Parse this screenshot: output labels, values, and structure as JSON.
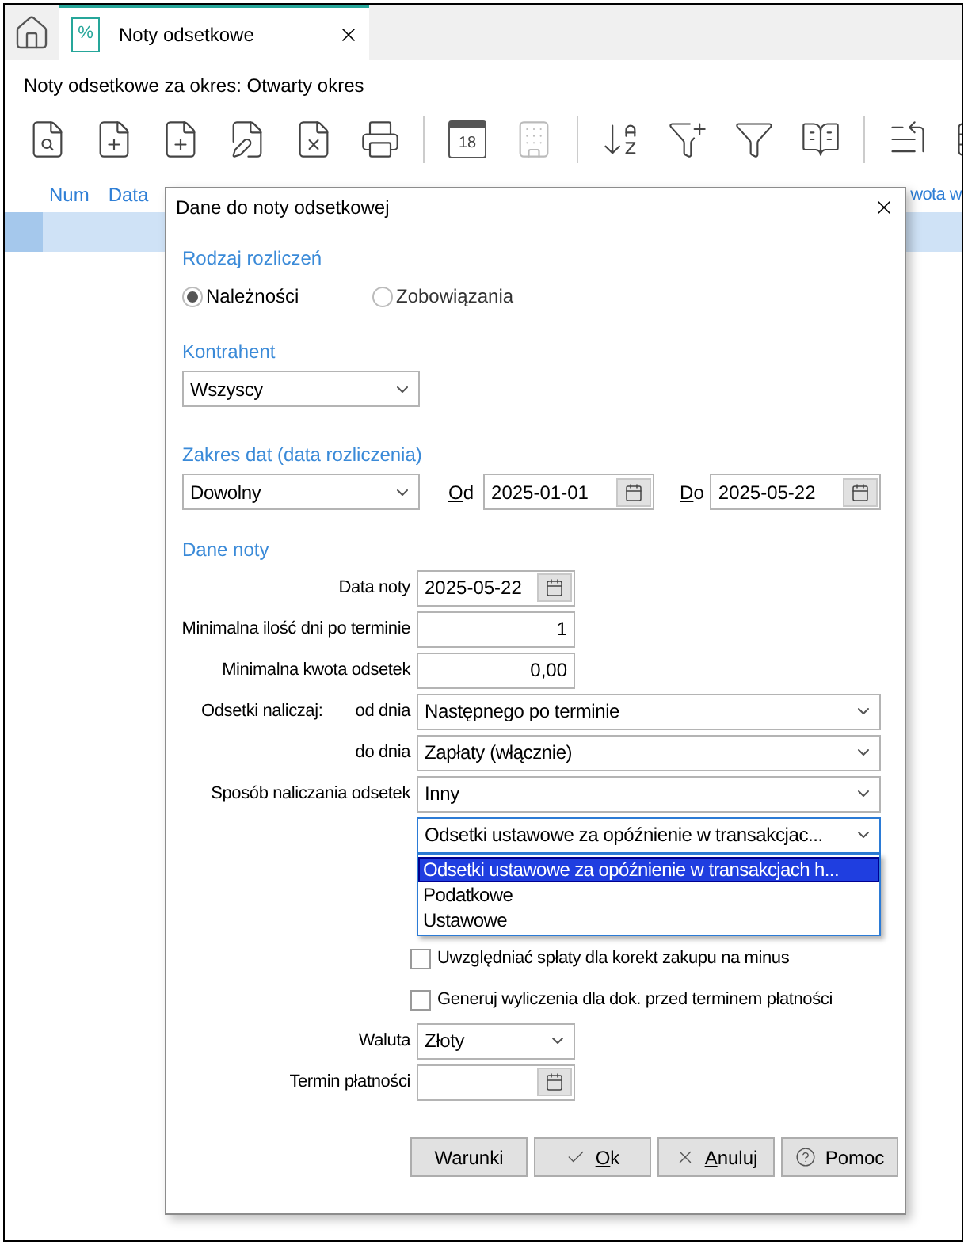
{
  "tab": {
    "icon_text": "%",
    "label": "Noty odsetkowe",
    "selected": true
  },
  "subtitle": "Noty odsetkowe za okres: Otwarty okres",
  "toolbar_groups": [
    {
      "items": [
        {
          "disabled": false
        },
        {
          "disabled": false
        },
        {
          "disabled": false
        },
        {
          "disabled": false
        },
        {
          "disabled": false
        },
        {
          "disabled": false
        }
      ]
    },
    {
      "items": [
        {
          "disabled": false,
          "icon_text": "18"
        },
        {
          "disabled": true
        }
      ]
    },
    {
      "items": [
        {
          "disabled": false
        },
        {
          "disabled": false
        },
        {
          "disabled": false
        },
        {
          "disabled": false
        }
      ]
    },
    {
      "items": [
        {
          "disabled": false
        },
        {
          "disabled": false
        }
      ]
    }
  ],
  "columns": [
    "Num",
    "Data"
  ],
  "column_right": "wota w",
  "rows": [
    {
      "selected": true
    }
  ],
  "dialog": {
    "title": "Dane do noty odsetkowej",
    "rodzaj": {
      "heading": "Rodzaj rozliczeń",
      "options": [
        {
          "label": "Należności",
          "selected": true
        },
        {
          "label": "Zobowiązania",
          "selected": false
        }
      ]
    },
    "kontrahent": {
      "heading": "Kontrahent",
      "value": "Wszyscy"
    },
    "zakres": {
      "heading": "Zakres dat (data rozliczenia)",
      "value": "Dowolny",
      "from": {
        "label": "Od",
        "underline_first": true,
        "value": "2025-01-01"
      },
      "to": {
        "label": "Do",
        "underline_first": true,
        "value": "2025-05-22"
      }
    },
    "dane_noty": {
      "heading": "Dane noty",
      "rows": [
        {
          "kind": "date",
          "label": "Data noty",
          "value": "2025-05-22"
        },
        {
          "kind": "number",
          "label": "Minimalna ilość dni po terminie",
          "value": "1"
        },
        {
          "kind": "number",
          "label": "Minimalna kwota odsetek",
          "value": "0,00"
        },
        {
          "kind": "select",
          "group_label": "Odsetki naliczaj:",
          "label": "od dnia",
          "value": "Następnego po terminie"
        },
        {
          "kind": "select",
          "label": "do dnia",
          "value": "Zapłaty (włącznie)"
        },
        {
          "kind": "select",
          "label": "Sposób naliczania odsetek",
          "value": "Inny"
        },
        {
          "kind": "select",
          "value": "Odsetki ustawowe za opóźnienie w transakcjac...",
          "expanded": true,
          "options": [
            {
              "label": "Odsetki ustawowe za opóźnienie w transakcjach h...",
              "selected": true
            },
            {
              "label": "Podatkowe",
              "selected": false
            },
            {
              "label": "Ustawowe",
              "selected": false
            }
          ]
        },
        {
          "kind": "checkbox",
          "label": "Uwzględniać spłaty dla korekt zakupu na minus",
          "checked": false
        },
        {
          "kind": "checkbox",
          "label": "Generuj wyliczenia dla dok. przed terminem płatności",
          "checked": false
        },
        {
          "kind": "select_short",
          "label": "Waluta",
          "value": "Złoty"
        },
        {
          "kind": "date",
          "label": "Termin płatności"
        }
      ]
    },
    "buttons": [
      {
        "kind": "plain",
        "label": "Warunki"
      },
      {
        "kind": "ok",
        "label": "Ok",
        "underline_first": true
      },
      {
        "kind": "cancel",
        "label": "Anuluj",
        "underline_first": true
      },
      {
        "kind": "help",
        "label": "Pomoc"
      }
    ]
  }
}
